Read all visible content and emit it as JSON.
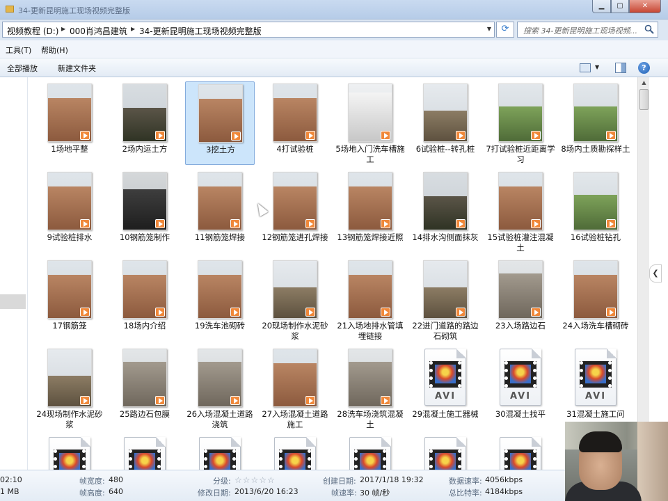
{
  "window": {
    "title": "34-更新昆明施工现场视频完整版",
    "buttons": {
      "minimize": "▁",
      "maximize": "▢",
      "close": "✕"
    }
  },
  "address": {
    "crumbs": [
      "视频教程 (D:)",
      "000肖鸿昌建筑",
      "34-更新昆明施工现场视频完整版"
    ],
    "search_placeholder": "搜索 34-更新昆明施工现场视频..."
  },
  "menu": {
    "tools": "工具(T)",
    "help": "帮助(H)"
  },
  "toolbar": {
    "play_all": "全部播放",
    "new_folder": "新建文件夹"
  },
  "colors": {
    "selection": "#cce5fb",
    "play_badge": "#f0883a",
    "accent": "#2a74c8"
  },
  "files": [
    {
      "label": "1场地平整",
      "kind": "video",
      "scene": "dirt"
    },
    {
      "label": "2场内运土方",
      "kind": "video",
      "scene": "dark"
    },
    {
      "label": "3挖土方",
      "kind": "video",
      "scene": "dirt",
      "selected": true
    },
    {
      "label": "4打试验桩",
      "kind": "video",
      "scene": "dirt"
    },
    {
      "label": "5场地入门洗车槽施工",
      "kind": "video",
      "scene": "paper"
    },
    {
      "label": "6试验桩--转孔桩",
      "kind": "video",
      "scene": "city"
    },
    {
      "label": "7打试验桩近距离学习",
      "kind": "video",
      "scene": "green"
    },
    {
      "label": "8场内土质勘探样土",
      "kind": "video",
      "scene": "green"
    },
    {
      "label": "9试验桩排水",
      "kind": "video",
      "scene": "dirt"
    },
    {
      "label": "10钢筋笼制作",
      "kind": "video",
      "scene": "coil"
    },
    {
      "label": "11钢筋笼焊接",
      "kind": "video",
      "scene": "dirt"
    },
    {
      "label": "12钢筋笼进孔焊接",
      "kind": "video",
      "scene": "dirt"
    },
    {
      "label": "13钢筋笼焊接近照",
      "kind": "video",
      "scene": "dirt"
    },
    {
      "label": "14排水沟侧面抹灰",
      "kind": "video",
      "scene": "dark"
    },
    {
      "label": "15试验桩灌注混凝土",
      "kind": "video",
      "scene": "dirt"
    },
    {
      "label": "16试验桩钻孔",
      "kind": "video",
      "scene": "green"
    },
    {
      "label": "17钢筋笼",
      "kind": "video",
      "scene": "dirt"
    },
    {
      "label": "18场内介绍",
      "kind": "video",
      "scene": "dirt"
    },
    {
      "label": "19洗车池砌砖",
      "kind": "video",
      "scene": "dirt"
    },
    {
      "label": "20现场制作水泥砂浆",
      "kind": "video",
      "scene": "city"
    },
    {
      "label": "21入场地排水管填埋链接",
      "kind": "video",
      "scene": "dirt"
    },
    {
      "label": "22进门道路的路边石砌筑",
      "kind": "video",
      "scene": "city"
    },
    {
      "label": "23入场路边石",
      "kind": "video",
      "scene": "gray"
    },
    {
      "label": "24入场洗车槽砌砖",
      "kind": "video",
      "scene": "dirt"
    },
    {
      "label": "24现场制作水泥砂浆",
      "kind": "video",
      "scene": "city"
    },
    {
      "label": "25路边石包膜",
      "kind": "video",
      "scene": "gray"
    },
    {
      "label": "26入场混凝土道路浇筑",
      "kind": "video",
      "scene": "gray"
    },
    {
      "label": "27入场混凝土道路施工",
      "kind": "video",
      "scene": "dirt"
    },
    {
      "label": "28洗车场浇筑混凝土",
      "kind": "video",
      "scene": "gray"
    },
    {
      "label": "29混凝土施工器械",
      "kind": "avi"
    },
    {
      "label": "30混凝土找平",
      "kind": "avi"
    },
    {
      "label": "31混凝土施工问",
      "kind": "avi"
    },
    {
      "label": "",
      "kind": "avi"
    },
    {
      "label": "",
      "kind": "avi"
    },
    {
      "label": "",
      "kind": "avi"
    },
    {
      "label": "",
      "kind": "avi"
    },
    {
      "label": "",
      "kind": "avi"
    },
    {
      "label": "",
      "kind": "avi"
    },
    {
      "label": "",
      "kind": "avi"
    }
  ],
  "avi_text": "AVI",
  "details": {
    "duration_partial": "02:10",
    "size_partial": "1 MB",
    "frame_width_label": "帧宽度:",
    "frame_width": "480",
    "frame_height_label": "帧高度:",
    "frame_height": "640",
    "rating_label": "分级:",
    "rating_stars": "☆☆☆☆☆",
    "modified_label": "修改日期:",
    "modified": "2013/6/20 16:23",
    "created_label": "创建日期:",
    "created": "2017/1/18 19:32",
    "frame_rate_label": "帧速率:",
    "frame_rate": "30 帧/秒",
    "data_rate_label": "数据速率:",
    "data_rate": "4056kbps",
    "bit_rate_label": "总比特率:",
    "bit_rate": "4184kbps"
  },
  "icons": {
    "refresh": "refresh-icon",
    "search": "search-icon",
    "help": "help-icon",
    "views": "view-icon",
    "preview_pane": "preview-pane-icon",
    "play": "play-badge-icon"
  }
}
